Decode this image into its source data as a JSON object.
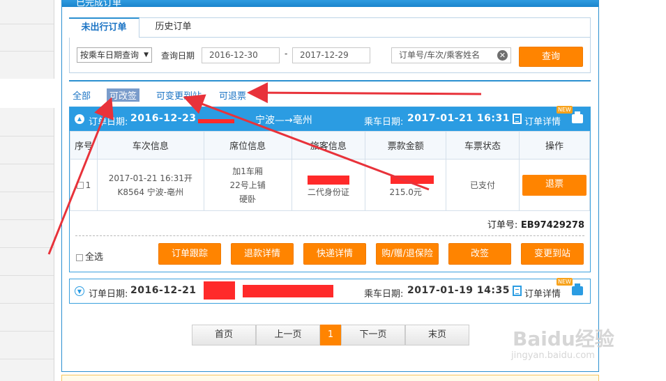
{
  "header": {
    "title": "已完成订单"
  },
  "tabs": [
    {
      "label": "未出行订单"
    },
    {
      "label": "历史订单"
    }
  ],
  "query": {
    "select_value": "按乘车日期查询",
    "date_label": "查询日期",
    "date_from": "2016-12-30",
    "date_sep": "-",
    "date_to": "2017-12-29",
    "search_placeholder": "订单号/车次/乘客姓名",
    "search_button": "查询"
  },
  "filters": [
    {
      "label": "全部"
    },
    {
      "label": "可改签"
    },
    {
      "label": "可变更到站"
    },
    {
      "label": "可退票"
    }
  ],
  "order1": {
    "order_date_label": "订单日期:",
    "order_date": "2016-12-23",
    "route": "宁波—→亳州",
    "ride_date_label": "乘车日期:",
    "ride_date": "2017-01-21 16:31",
    "detail_link": "订单详情",
    "new_badge": "NEW",
    "columns": [
      "序号",
      "车次信息",
      "席位信息",
      "旅客信息",
      "票款金额",
      "车票状态",
      "操作"
    ],
    "row": {
      "index": "1",
      "train_line1": "2017-01-21 16:31开",
      "train_line2": "K8564 宁波-亳州",
      "seat_line1": "加1车厢",
      "seat_line2": "22号上铺",
      "seat_line3": "硬卧",
      "passenger_id": "二代身份证",
      "price": "215.0元",
      "status": "已支付",
      "action": "退票"
    },
    "order_no_label": "订单号:",
    "order_no": "EB97429278",
    "select_all": "全选",
    "actions": [
      "订单跟踪",
      "退款详情",
      "快递详情",
      "购/赠/退保险",
      "改签",
      "变更到站"
    ]
  },
  "order2": {
    "order_date_label": "订单日期:",
    "order_date": "2016-12-21",
    "ride_date_label": "乘车日期:",
    "ride_date": "2017-01-19 14:35",
    "detail_link": "订单详情",
    "new_badge": "NEW"
  },
  "pagination": {
    "first": "首页",
    "prev": "上一页",
    "current": "1",
    "next": "下一页",
    "last": "末页"
  },
  "watermark": {
    "brand": "Baidu经验",
    "url": "jingyan.baidu.com"
  },
  "colors": {
    "accent": "#2b9ce2",
    "button": "#ff8400",
    "annotation": "#e8323a"
  }
}
